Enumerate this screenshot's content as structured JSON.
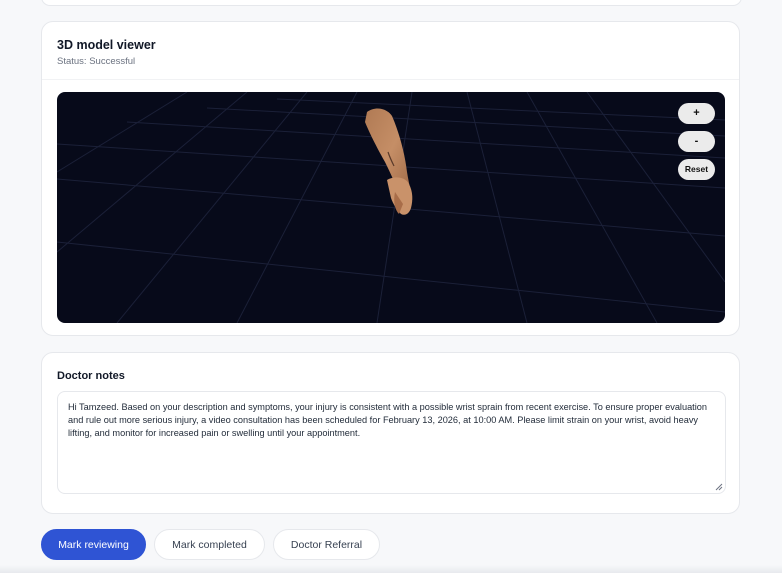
{
  "viewer": {
    "title": "3D model viewer",
    "status": "Status: Successful",
    "controls": {
      "zoom_in": "+",
      "zoom_out": "-",
      "reset": "Reset"
    }
  },
  "notes": {
    "title": "Doctor notes",
    "text": "Hi Tamzeed. Based on your description and symptoms, your injury is consistent with a possible wrist sprain from recent exercise. To ensure proper evaluation and rule out more serious injury, a video consultation has been scheduled for February 13, 2026, at 10:00 AM. Please limit strain on your wrist, avoid heavy lifting, and monitor for increased pain or swelling until your appointment."
  },
  "actions": {
    "mark_reviewing": "Mark reviewing",
    "mark_completed": "Mark completed",
    "doctor_referral": "Doctor Referral"
  },
  "colors": {
    "primary": "#2f54d4",
    "viewport_bg": "#070a1a",
    "card_border": "#e6e8ec"
  }
}
